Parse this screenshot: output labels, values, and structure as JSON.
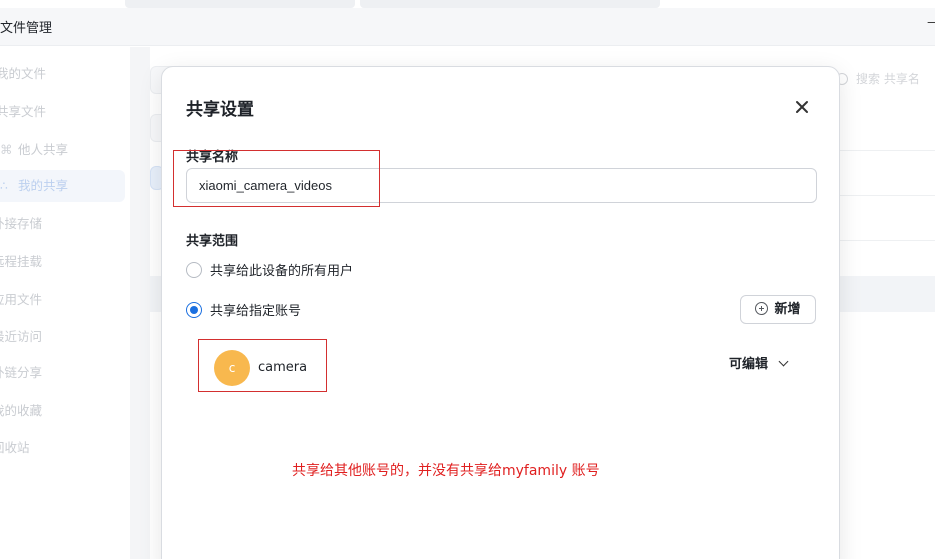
{
  "app": {
    "title": "文件管理",
    "window_minimize": "—"
  },
  "sidebar": {
    "items": [
      {
        "label": "我的文件",
        "icon": ""
      },
      {
        "label": "共享文件",
        "icon": ""
      },
      {
        "label": "他人共享",
        "icon": "users-icon"
      },
      {
        "label": "我的共享",
        "icon": "share-icon",
        "active": true
      },
      {
        "label": "外接存储",
        "icon": ""
      },
      {
        "label": "远程挂载",
        "icon": ""
      },
      {
        "label": "应用文件",
        "icon": ""
      },
      {
        "label": "最近访问",
        "icon": ""
      },
      {
        "label": "外链分享",
        "icon": ""
      },
      {
        "label": "我的收藏",
        "icon": ""
      },
      {
        "label": "回收站",
        "icon": ""
      }
    ]
  },
  "search": {
    "placeholder": "搜索 共享名"
  },
  "dialog": {
    "title": "共享设置",
    "close_icon": "close-icon",
    "name_label": "共享名称",
    "name_value": "xiaomi_camera_videos",
    "scope_label": "共享范围",
    "option_all": "共享给此设备的所有用户",
    "option_specific": "共享给指定账号",
    "selected_option": "option_specific",
    "add_button": "新增",
    "users": [
      {
        "avatar_letter": "c",
        "name": "camera",
        "permission": "可编辑",
        "avatar_color": "#f8b84e"
      }
    ]
  },
  "annotation": {
    "note": "共享给其他账号的，并没有共享给myfamily 账号",
    "color": "#e02020"
  },
  "colors": {
    "accent": "#1a6fe0",
    "annotation_box": "#d32f2f"
  }
}
